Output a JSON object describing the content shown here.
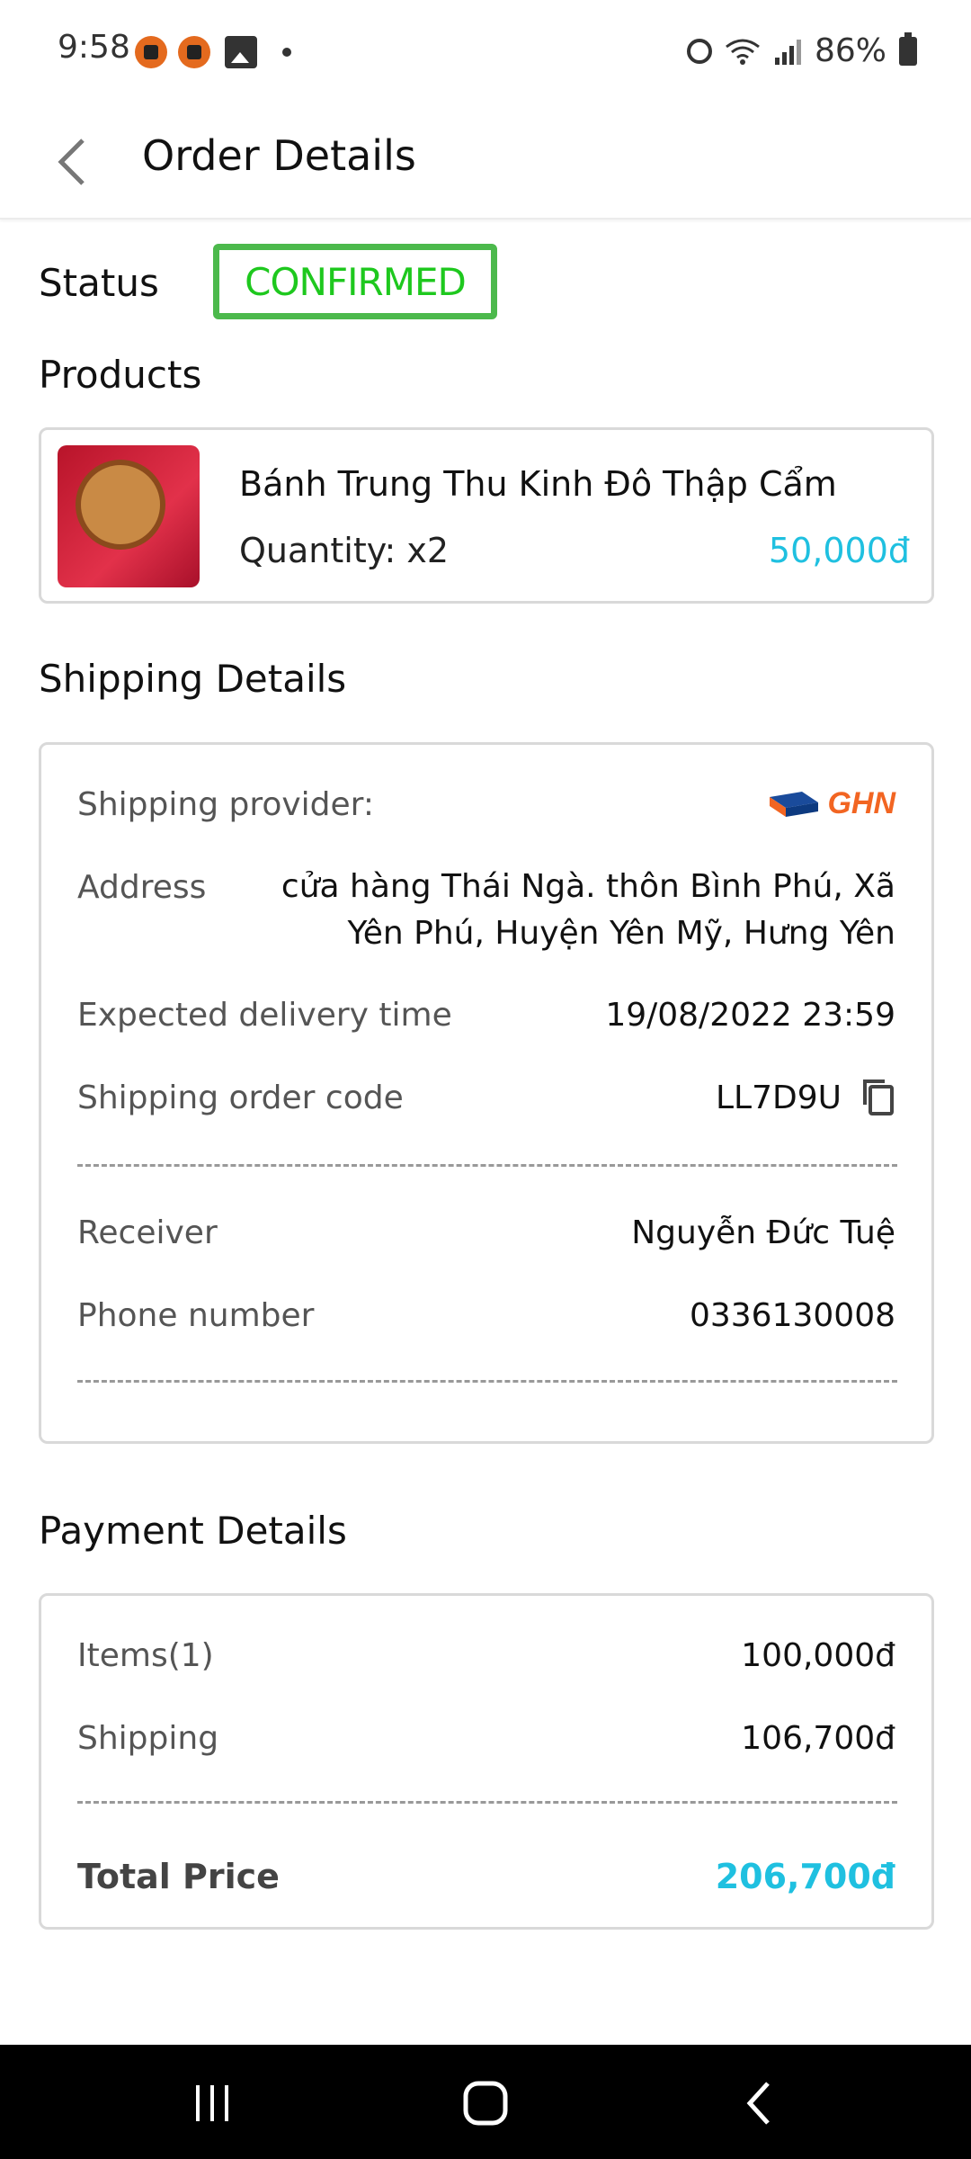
{
  "status_bar": {
    "time": "9:58",
    "battery": "86%"
  },
  "header": {
    "title": "Order Details"
  },
  "status": {
    "label": "Status",
    "value": "CONFIRMED",
    "color": "#1ec81e"
  },
  "products": {
    "title": "Products",
    "items": [
      {
        "name": "Bánh Trung Thu Kinh Đô Thập Cẩm",
        "quantity": "Quantity: x2",
        "price": "50,000đ"
      }
    ]
  },
  "shipping": {
    "title": "Shipping Details",
    "provider_label": "Shipping provider:",
    "provider_logo_text": "GHN",
    "address_label": "Address",
    "address_value": "cửa hàng Thái Ngà. thôn Bình Phú, Xã Yên Phú, Huyện Yên Mỹ, Hưng Yên",
    "delivery_label": "Expected delivery time",
    "delivery_value": "19/08/2022 23:59",
    "order_code_label": "Shipping order code",
    "order_code_value": "LL7D9U",
    "receiver_label": "Receiver",
    "receiver_value": "Nguyễn Đức Tuệ",
    "phone_label": "Phone number",
    "phone_value": "0336130008"
  },
  "payment": {
    "title": "Payment Details",
    "items_label": "Items(1)",
    "items_value": "100,000đ",
    "shipping_label": "Shipping",
    "shipping_value": "106,700đ",
    "total_label": "Total Price",
    "total_value": "206,700đ"
  },
  "colors": {
    "accent": "#1fc0e0",
    "status_green": "#1ec81e",
    "ghn_orange": "#f26522"
  },
  "icons": [
    "back-arrow-icon",
    "copy-icon",
    "recent-apps-icon",
    "home-icon",
    "nav-back-icon",
    "alarm-icon",
    "wifi-icon",
    "signal-icon",
    "battery-icon"
  ]
}
